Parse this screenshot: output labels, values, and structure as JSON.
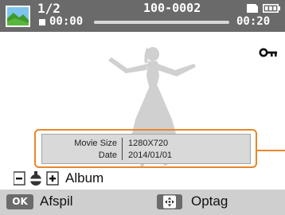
{
  "status_bar": {
    "file_counter": "1/2",
    "folder_file_number": "100-0002",
    "elapsed_time": "00:00",
    "total_time": "00:20",
    "playback_progress": 0.0
  },
  "info_panel": {
    "rows": [
      {
        "label": "Movie Size",
        "value": "1280X720"
      },
      {
        "label": "Date",
        "value": "2014/01/01"
      }
    ]
  },
  "album_row": {
    "label": "Album"
  },
  "bottom_bar": {
    "ok_key": "OK",
    "ok_action": "Afspil",
    "nav_action": "Optag"
  },
  "icons": {
    "thumbnail": "movie-thumbnail-icon",
    "memory_card": "memory-card-icon",
    "battery": "battery-full-icon",
    "stop": "stop-icon",
    "protect": "protect-key-icon",
    "zoom": "zoom-lever-icon",
    "nav": "four-way-nav-icon"
  },
  "colors": {
    "top_bar": "#6a6a6a",
    "bottom_bar": "#cfcfcf",
    "callout_accent": "#e8872a",
    "info_box": "#d9d9d9"
  }
}
